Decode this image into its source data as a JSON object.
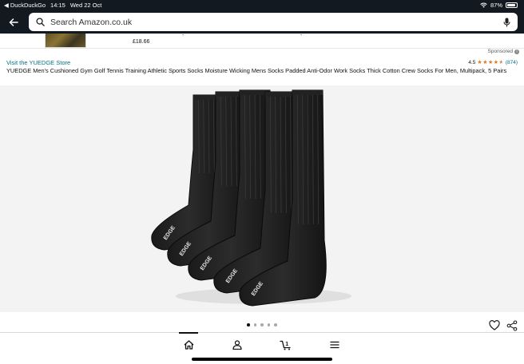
{
  "status_bar": {
    "carrier": "DuckDuckGo",
    "time": "14:15",
    "date": "Wed 22 Oct",
    "battery_percent": "87%",
    "battery_level": 0.87
  },
  "header": {
    "search_placeholder": "Search Amazon.co.uk"
  },
  "previous_item": {
    "price": "£18.66"
  },
  "ad": {
    "sponsored_label": "Sponsored",
    "store_link": "Visit the YUEDGE Store",
    "rating_value": "4.5",
    "rating_stars": 4.5,
    "rating_count": "(874)",
    "title": "YUEDGE Men's Cushioned Gym Golf Tennis Training Athletic Sports Socks Moisture Wicking Mens Socks Padded Anti-Odor Work Socks Thick Cotton Crew Socks For Men, Multipack, 5 Pairs",
    "sock_brand_print": "EDGE"
  },
  "carousel": {
    "total": 5,
    "active_index": 0
  },
  "cart": {
    "count": "1"
  },
  "colors": {
    "header_bg": "#131921",
    "link": "#007185",
    "star": "#de7921",
    "image_bg": "#f3f3f3"
  },
  "icons": {
    "back": "arrow-left-icon",
    "search": "search-icon",
    "mic": "microphone-icon",
    "wishlist": "heart-icon",
    "share": "share-icon",
    "home": "home-icon",
    "account": "person-icon",
    "cart": "cart-icon",
    "menu": "hamburger-menu-icon"
  }
}
